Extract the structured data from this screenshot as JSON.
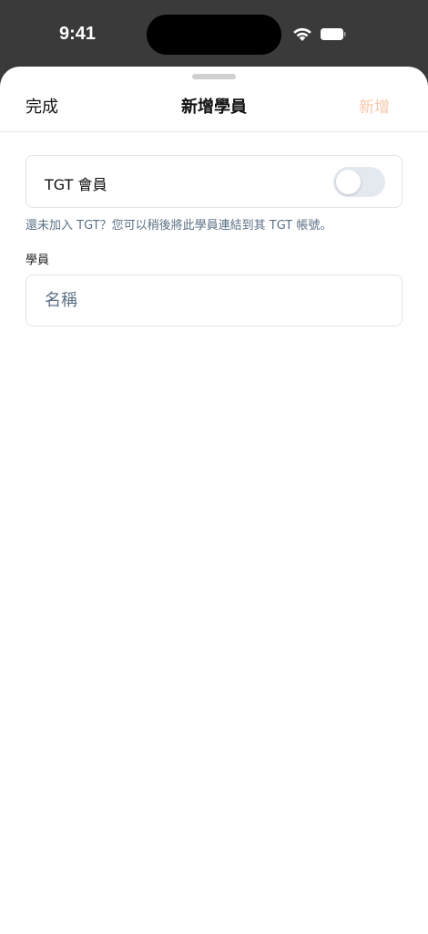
{
  "status_bar": {
    "time": "9:41"
  },
  "nav": {
    "done_label": "完成",
    "title": "新增學員",
    "add_label": "新增"
  },
  "member_toggle": {
    "label": "TGT 會員",
    "on": false
  },
  "hint_text": "還未加入 TGT？您可以稍後將此學員連結到其 TGT 帳號。",
  "student_section": {
    "label": "學員",
    "name_value": "",
    "name_placeholder": "名稱"
  },
  "colors": {
    "accent_disabled": "#f9c6ab",
    "hint": "#5d7186",
    "toggle_off": "#e4e8ef"
  }
}
